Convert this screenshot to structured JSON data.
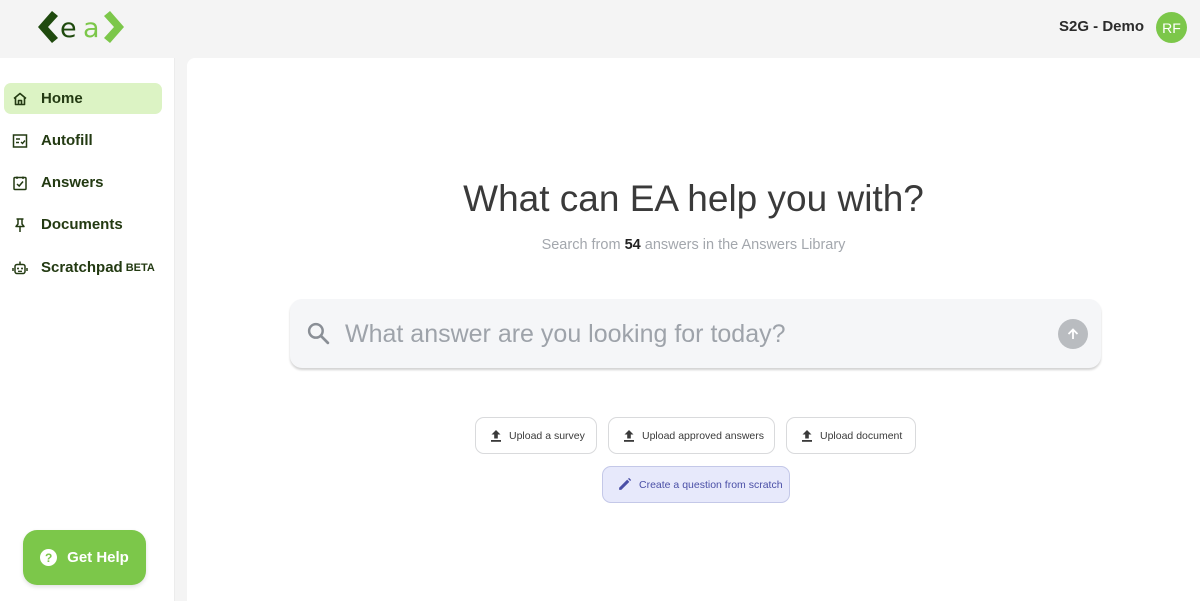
{
  "header": {
    "workspace": "S2G - Demo",
    "avatar_initials": "RF"
  },
  "sidebar": {
    "items": [
      {
        "label": "Home",
        "icon": "home-icon",
        "active": true
      },
      {
        "label": "Autofill",
        "icon": "checklist-icon"
      },
      {
        "label": "Answers",
        "icon": "checkbox-icon"
      },
      {
        "label": "Documents",
        "icon": "pin-icon"
      },
      {
        "label": "Scratchpad",
        "icon": "robot-icon",
        "badge": "BETA"
      }
    ],
    "help_label": "Get Help"
  },
  "main": {
    "headline": "What can EA help you with?",
    "sub_prefix": "Search from",
    "sub_count": "54",
    "sub_suffix": "answers in the Answers Library",
    "search_placeholder": "What answer are you looking for today?",
    "actions": [
      {
        "label": "Upload a survey",
        "icon": "upload-icon"
      },
      {
        "label": "Upload approved answers",
        "icon": "upload-icon"
      },
      {
        "label": "Upload document",
        "icon": "upload-icon"
      },
      {
        "label": "Create a question from scratch",
        "icon": "pencil-icon"
      }
    ]
  },
  "colors": {
    "brand_green": "#7cc74a",
    "dark_green": "#1f4a0e",
    "active_bg": "#dcf3c4",
    "accent_purple": "#4a4fa6"
  }
}
